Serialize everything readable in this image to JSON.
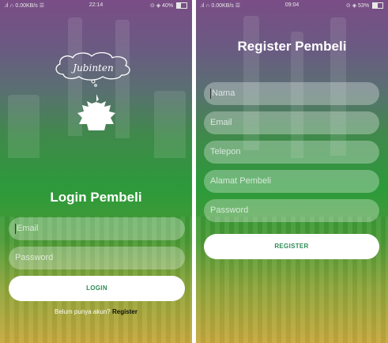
{
  "login_screen": {
    "status_bar": {
      "left": ".ıl ∩ 0.00KB/s ☰",
      "time": "22:14",
      "right": "⊙ ◈ 40%",
      "battery_level": 0.4
    },
    "logo_text": "Jubinten",
    "title": "Login Pembeli",
    "email_placeholder": "Email",
    "password_placeholder": "Password",
    "login_button": "LOGIN",
    "footer_text": "Belum punya akun?",
    "register_link": "Register"
  },
  "register_screen": {
    "status_bar": {
      "left": ".ıl ∩ 0.00KB/s ☰",
      "time": "09:04",
      "right": "⊙ ◈ 53%",
      "battery_level": 0.53
    },
    "title": "Register Pembeli",
    "fields": [
      "Nama",
      "Email",
      "Telepon",
      "Alamat Pembeli",
      "Password"
    ],
    "register_button": "REGISTER"
  },
  "colors": {
    "button_text": "#2e8b57",
    "gradient_top": "#7a4d86",
    "gradient_mid": "#2c9a3a",
    "gradient_bottom": "#c6a83c"
  },
  "icons": [
    "cloud-logo-icon",
    "crown-icon",
    "battery-icon"
  ]
}
